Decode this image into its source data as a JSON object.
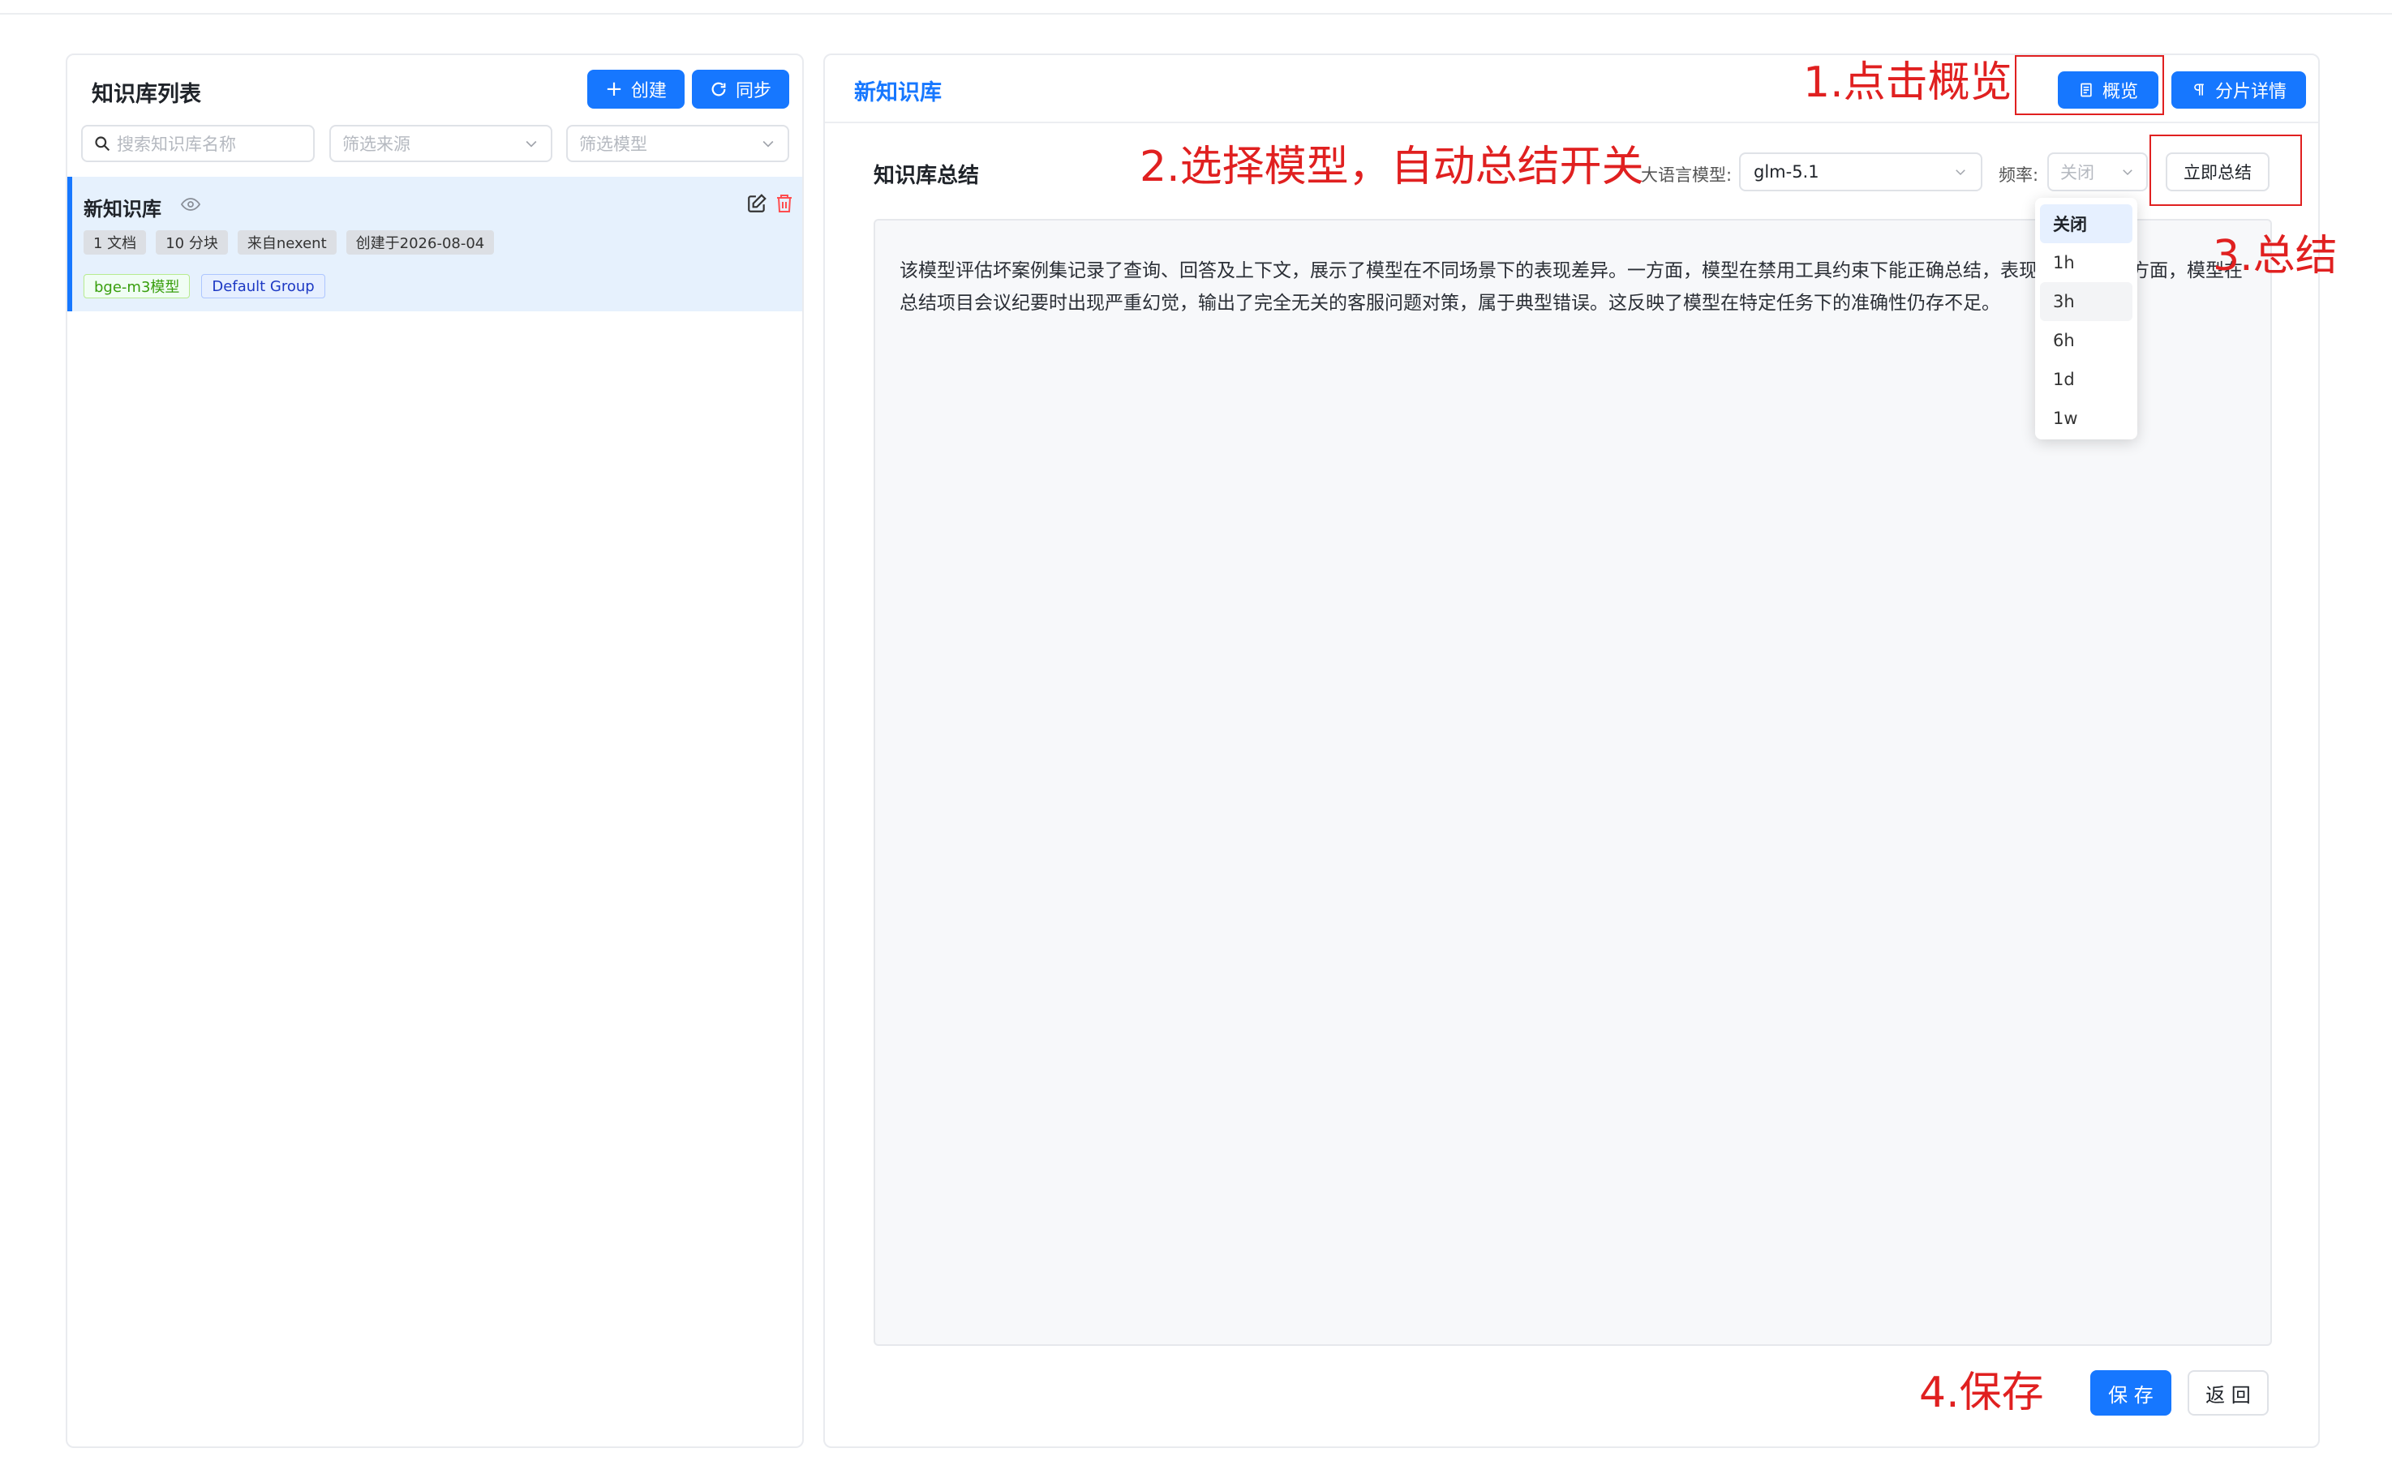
{
  "left": {
    "title": "知识库列表",
    "create_label": "创建",
    "sync_label": "同步",
    "search_placeholder": "搜索知识库名称",
    "source_filter_placeholder": "筛选来源",
    "model_filter_placeholder": "筛选模型",
    "kb": {
      "name": "新知识库",
      "chips": [
        "1 文档",
        "10 分块",
        "来自nexent",
        "创建于2026-08-04"
      ],
      "tag_model": "bge-m3模型",
      "tag_group": "Default Group"
    }
  },
  "right": {
    "title": "新知识库",
    "overview_label": "概览",
    "chunks_label": "分片详情",
    "section_title": "知识库总结",
    "llm_label": "大语言模型:",
    "llm_value": "glm-5.1",
    "freq_label": "频率:",
    "freq_value": "关闭",
    "summarize_now_label": "立即总结",
    "summary_text": "该模型评估坏案例集记录了查询、回答及上下文，展示了模型在不同场景下的表现差异。一方面，模型在禁用工具约束下能正确总结，表现良好；另一方面，模型在总结项目会议纪要时出现严重幻觉，输出了完全无关的客服问题对策，属于典型错误。这反映了模型在特定任务下的准确性仍存不足。",
    "save_label": "保 存",
    "back_label": "返 回",
    "freq_options": [
      "关闭",
      "1h",
      "3h",
      "6h",
      "1d",
      "1w"
    ]
  },
  "annotations": {
    "step1": "1.点击概览",
    "step2": "2.选择模型，自动总结开关",
    "step3": "3.总结",
    "step4": "4.保存"
  },
  "colors": {
    "primary": "#1677ff",
    "annotation": "#e02020"
  }
}
